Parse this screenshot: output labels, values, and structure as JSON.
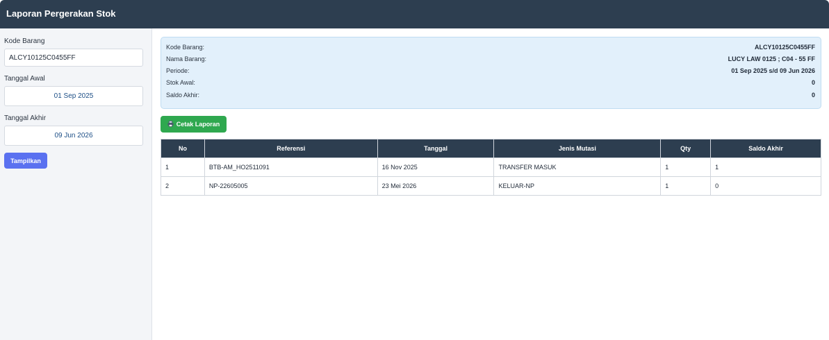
{
  "header": {
    "title": "Laporan Pergerakan Stok"
  },
  "filters": {
    "kode_barang_label": "Kode Barang",
    "kode_barang_value": "ALCY10125C0455FF",
    "tanggal_awal_label": "Tanggal Awal",
    "tanggal_awal_value": "01 Sep 2025",
    "tanggal_akhir_label": "Tanggal Akhir",
    "tanggal_akhir_value": "09 Jun 2026",
    "submit_label": "Tampilkan"
  },
  "info": {
    "rows": [
      {
        "label": "Kode Barang:",
        "value": "ALCY10125C0455FF"
      },
      {
        "label": "Nama Barang:",
        "value": "LUCY LAW 0125 ; C04 - 55 FF"
      },
      {
        "label": "Periode:",
        "value": "01 Sep 2025 s/d 09 Jun 2026"
      },
      {
        "label": "Stok Awal:",
        "value": "0"
      },
      {
        "label": "Saldo Akhir:",
        "value": "0"
      }
    ]
  },
  "actions": {
    "print_label": "Cetak Laporan",
    "print_icon": "printer-icon"
  },
  "table": {
    "columns": [
      "No",
      "Referensi",
      "Tanggal",
      "Jenis Mutasi",
      "Qty",
      "Saldo Akhir"
    ],
    "rows": [
      [
        "1",
        "BTB-AM_HO2511091",
        "16 Nov 2025",
        "TRANSFER MASUK",
        "1",
        "1"
      ],
      [
        "2",
        "NP-22605005",
        "23 Mei 2026",
        "KELUAR-NP",
        "1",
        "0"
      ]
    ]
  },
  "colors": {
    "header_bg": "#2d3e50",
    "primary_button": "#5a71f0",
    "success_button": "#2fa84f",
    "info_bg": "#e2f0fb"
  }
}
